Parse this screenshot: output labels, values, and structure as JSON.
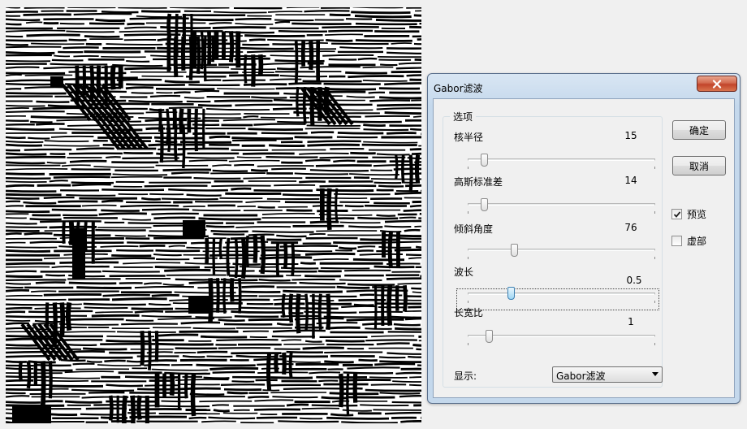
{
  "dialog": {
    "title": "Gabor滤波",
    "group_label": "选项",
    "sliders": [
      {
        "key": "kernel_radius",
        "label": "核半径",
        "value": "15",
        "position": 0.07
      },
      {
        "key": "gaussian_sigma",
        "label": "高斯标准差",
        "value": "14",
        "position": 0.07
      },
      {
        "key": "tilt_angle",
        "label": "倾斜角度",
        "value": "76",
        "position": 0.24
      },
      {
        "key": "wavelength",
        "label": "波长",
        "value": "0.5",
        "position": 0.22
      },
      {
        "key": "aspect_ratio",
        "label": "长宽比",
        "value": "1",
        "position": 0.1
      }
    ],
    "display_label": "显示:",
    "display_selected": "Gabor滤波",
    "ok_label": "确定",
    "cancel_label": "取消",
    "preview_label": "预览",
    "preview_checked": true,
    "imaginary_label": "虚部",
    "imaginary_checked": false
  },
  "colors": {
    "title_bar": "#c4d8ec",
    "close_button": "#c2442a",
    "active_thumb": "#9fd6f3"
  }
}
